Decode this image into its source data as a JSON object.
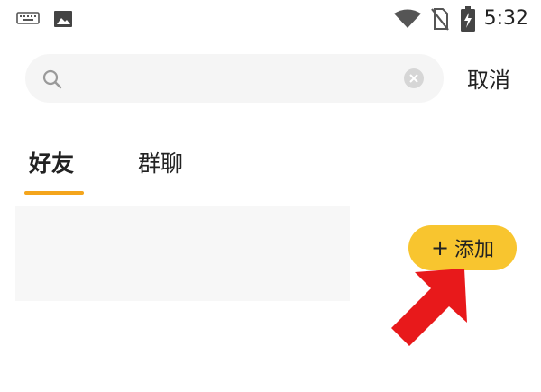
{
  "status_bar": {
    "time": "5:32",
    "icons": [
      "keyboard-icon",
      "image-icon",
      "wifi-icon",
      "no-sim-icon",
      "battery-charging-icon"
    ]
  },
  "search": {
    "placeholder": "",
    "value": "",
    "cancel_label": "取消"
  },
  "tabs": [
    {
      "label": "好友",
      "active": true
    },
    {
      "label": "群聊",
      "active": false
    }
  ],
  "actions": {
    "add_label": "添加",
    "add_icon": "plus-icon"
  },
  "colors": {
    "accent": "#f4a51c",
    "add_button": "#f8c52f",
    "arrow": "#e8191b",
    "search_bg": "#f5f5f5"
  }
}
